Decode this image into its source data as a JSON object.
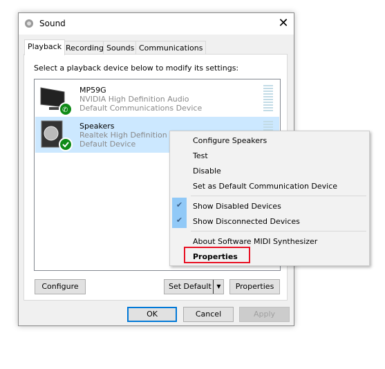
{
  "window": {
    "title": "Sound",
    "close_icon": "close-icon"
  },
  "tabs": [
    {
      "label": "Playback",
      "selected": true
    },
    {
      "label": "Recording"
    },
    {
      "label": "Sounds"
    },
    {
      "label": "Communications"
    }
  ],
  "instruction": "Select a playback device below to modify its settings:",
  "devices": [
    {
      "name": "MP59G",
      "driver": "NVIDIA High Definition Audio",
      "status": "Default Communications Device",
      "icon": "monitor-icon",
      "badge": "phone-badge-icon"
    },
    {
      "name": "Speakers",
      "driver": "Realtek High Definition Audio",
      "status": "Default Device",
      "icon": "speaker-icon",
      "badge": "check-badge-icon",
      "selected": true
    }
  ],
  "buttons": {
    "configure": "Configure",
    "set_default": "Set Default",
    "properties": "Properties",
    "ok": "OK",
    "cancel": "Cancel",
    "apply": "Apply"
  },
  "context_menu": {
    "items": [
      "Configure Speakers",
      "Test",
      "Disable",
      "Set as Default Communication Device",
      "Show Disabled Devices",
      "Show Disconnected Devices",
      "About Software MIDI Synthesizer",
      "Properties"
    ],
    "checked": [
      "Show Disabled Devices",
      "Show Disconnected Devices"
    ]
  },
  "colors": {
    "selection": "#cce8ff",
    "highlight_box": "#e81123",
    "badge_green": "#0e8a16"
  }
}
